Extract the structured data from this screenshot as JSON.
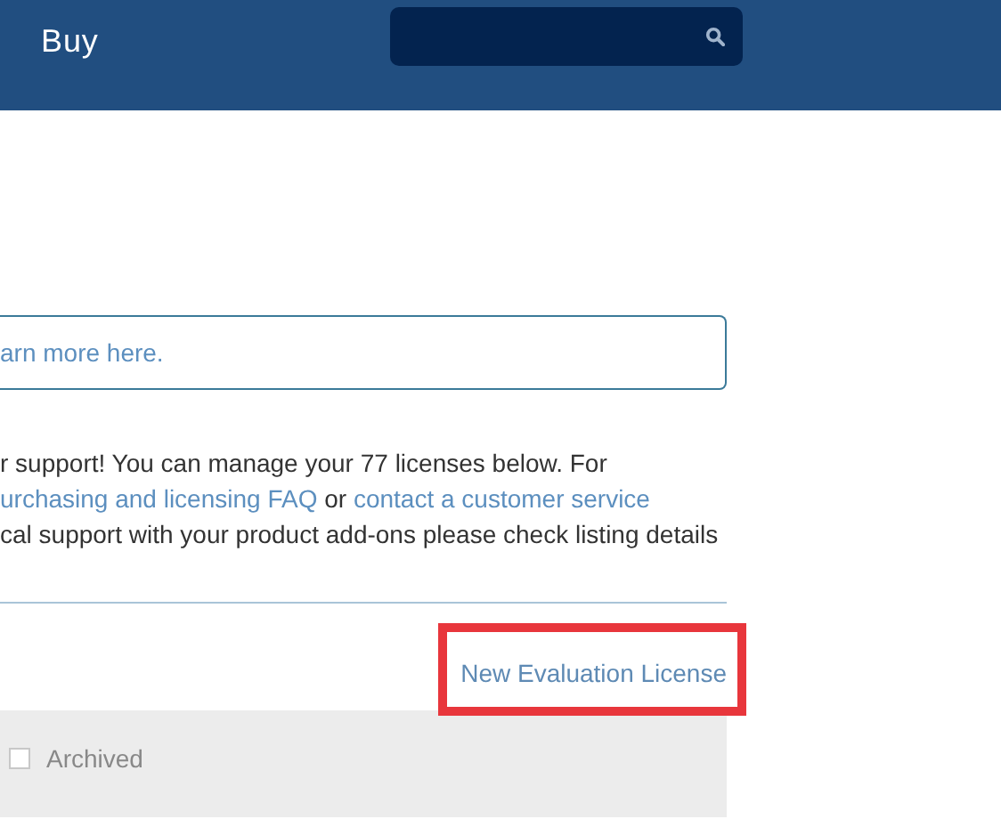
{
  "header": {
    "title": "Buy"
  },
  "notice": {
    "link": "arn more here."
  },
  "intro": {
    "lines": [
      [
        {
          "kind": "text",
          "text": "r support! You can manage your 77 licenses below. For"
        }
      ],
      [
        {
          "kind": "link",
          "text": "urchasing and licensing FAQ"
        },
        {
          "kind": "text",
          "text": " or "
        },
        {
          "kind": "link",
          "text": "contact a customer service"
        }
      ],
      [
        {
          "kind": "text",
          "text": "cal support with your product add-ons please check listing details"
        }
      ]
    ]
  },
  "new_license": {
    "label": "New Evaluation License",
    "highlighted": true
  },
  "filters": [
    {
      "label": "Archived",
      "checked": false
    }
  ]
}
